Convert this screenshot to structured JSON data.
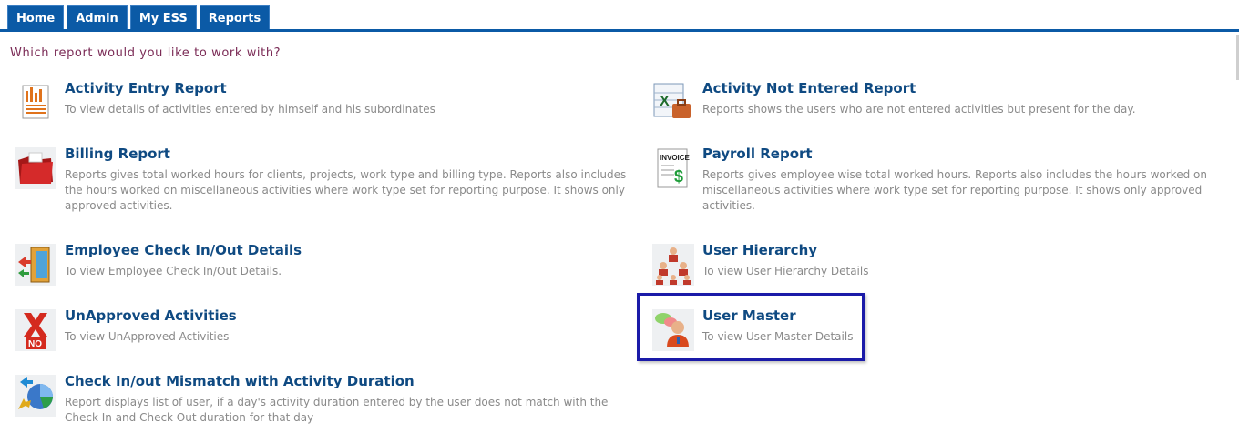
{
  "nav": {
    "tabs": [
      {
        "label": "Home"
      },
      {
        "label": "Admin"
      },
      {
        "label": "My ESS"
      },
      {
        "label": "Reports"
      }
    ]
  },
  "page": {
    "heading": "Which report would you like to work with?"
  },
  "reports": [
    {
      "title": "Activity Entry Report",
      "description": "To view details of activities entered by himself and his subordinates",
      "icon": "bar-chart-document-icon"
    },
    {
      "title": "Activity Not Entered Report",
      "description": "Reports shows the users who are not entered activities but present for the day.",
      "icon": "excel-briefcase-icon"
    },
    {
      "title": "Billing Report",
      "description": "Reports gives total worked hours for clients, projects, work type and billing type. Reports also includes the hours worked on miscellaneous activities where work type set for reporting purpose. It shows only approved activities.",
      "icon": "red-folder-icon"
    },
    {
      "title": "Payroll Report",
      "description": "Reports gives employee wise total worked hours. Reports also includes the hours worked on miscellaneous activities where work type set for reporting purpose. It shows only approved activities.",
      "icon": "invoice-dollar-icon",
      "icon_text": "INVOICE"
    },
    {
      "title": "Employee Check In/Out Details",
      "description": "To view Employee Check In/Out Details.",
      "icon": "door-exit-icon"
    },
    {
      "title": "User Hierarchy",
      "description": "To view User Hierarchy Details",
      "icon": "user-hierarchy-icon"
    },
    {
      "title": "UnApproved Activities",
      "description": "To view UnApproved Activities",
      "icon": "red-x-no-icon",
      "icon_text": "NO"
    },
    {
      "title": "User Master",
      "description": "To view User Master Details",
      "icon": "user-chat-icon",
      "highlighted": true
    },
    {
      "title": "Check In/out Mismatch with Activity Duration",
      "description": "Report displays list of user, if a day's activity duration entered by the user does not match with the Check In and Check Out duration for that day",
      "icon": "pie-chart-arrows-icon"
    }
  ]
}
